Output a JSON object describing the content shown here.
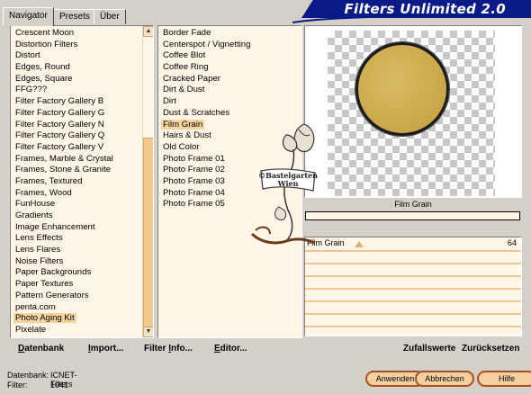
{
  "tabs": [
    {
      "label": "Navigator",
      "active": true
    },
    {
      "label": "Presets",
      "active": false
    },
    {
      "label": "Über",
      "active": false
    }
  ],
  "banner": {
    "title": "Filters Unlimited 2.0",
    "color": "#0a1a86"
  },
  "categories": {
    "items": [
      "Crescent Moon",
      "Distortion Filters",
      "Distort",
      "Edges, Round",
      "Edges, Square",
      "FFG???",
      "Filter Factory Gallery B",
      "Filter Factory Gallery G",
      "Filter Factory Gallery N",
      "Filter Factory Gallery Q",
      "Filter Factory Gallery V",
      "Frames, Marble & Crystal",
      "Frames, Stone & Granite",
      "Frames, Textured",
      "Frames, Wood",
      "FunHouse",
      "Gradients",
      "Image Enhancement",
      "Lens Effects",
      "Lens Flares",
      "Noise Filters",
      "Paper Backgrounds",
      "Paper Textures",
      "Pattern Generators",
      "penta.com",
      "Photo Aging Kit",
      "Pixelate"
    ],
    "selected": "Photo Aging Kit"
  },
  "filters": {
    "items": [
      "Border Fade",
      "Centerspot / Vignetting",
      "Coffee Blot",
      "Coffee Ring",
      "Cracked Paper",
      "Dirt & Dust",
      "Dirt",
      "Dust & Scratches",
      "Film Grain",
      "Hairs & Dust",
      "Old Color",
      "Photo Frame 01",
      "Photo Frame 02",
      "Photo Frame 03",
      "Photo Frame 04",
      "Photo Frame 05"
    ],
    "selected": "Film Grain"
  },
  "preview": {
    "caption": "Film Grain",
    "fill_color": "#c9a748"
  },
  "sliders": [
    {
      "label": "Film Grain",
      "value": "64",
      "fraction": 0.251
    }
  ],
  "toolbar": {
    "datenbank": {
      "u": "D",
      "rest": "atenbank"
    },
    "import": {
      "u": "I",
      "rest": "mport..."
    },
    "filterinfo": {
      "pre": "Filter ",
      "u": "I",
      "rest": "nfo..."
    },
    "editor": {
      "u": "E",
      "rest": "ditor..."
    },
    "zufallswerte": "Zufallswerte",
    "zuruecksetzen": "Zurücksetzen"
  },
  "status": {
    "db_label": "Datenbank:",
    "db_value": "ICNET-Filters",
    "filter_label": "Filter:",
    "filter_value": "1041"
  },
  "buttons": {
    "apply": "Anwenden",
    "cancel": "Abbrechen",
    "help": "Hilfe"
  },
  "watermark": {
    "text_line1": "©Bastelgarten",
    "text_line2": "Wien"
  }
}
